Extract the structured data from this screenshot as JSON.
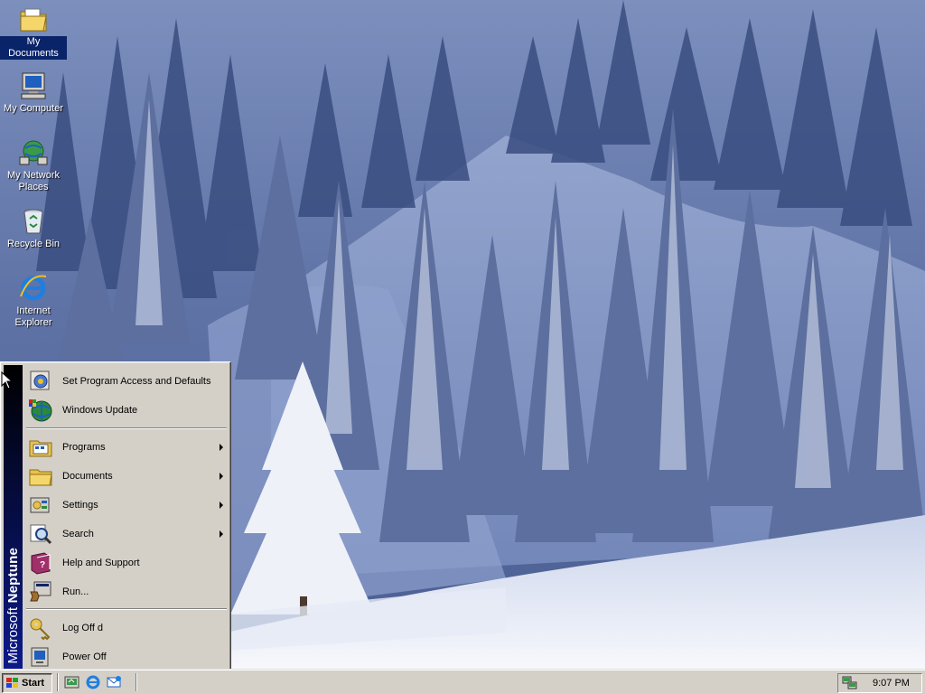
{
  "desktop": {
    "icons": [
      {
        "label": "My Documents",
        "icon": "my-documents-icon",
        "selected": true
      },
      {
        "label": "My Computer",
        "icon": "my-computer-icon"
      },
      {
        "label": "My Network Places",
        "icon": "network-places-icon"
      },
      {
        "label": "Recycle Bin",
        "icon": "recycle-bin-icon"
      },
      {
        "label": "Internet Explorer",
        "icon": "internet-explorer-icon"
      }
    ]
  },
  "start_menu": {
    "banner_prefix": "Microsoft",
    "banner_name": "Neptune",
    "items": [
      {
        "label": "Set Program Access and Defaults",
        "icon": "program-access-icon",
        "submenu": false
      },
      {
        "label": "Windows Update",
        "icon": "windows-update-icon",
        "submenu": false
      },
      {
        "label": "Programs",
        "icon": "programs-folder-icon",
        "submenu": true
      },
      {
        "label": "Documents",
        "icon": "documents-folder-icon",
        "submenu": true
      },
      {
        "label": "Settings",
        "icon": "settings-icon",
        "submenu": true
      },
      {
        "label": "Search",
        "icon": "search-icon",
        "submenu": true
      },
      {
        "label": "Help and Support",
        "icon": "help-book-icon",
        "submenu": false
      },
      {
        "label": "Run...",
        "icon": "run-icon",
        "submenu": false
      },
      {
        "label": "Log Off d",
        "icon": "log-off-key-icon",
        "submenu": false
      },
      {
        "label": "Power Off",
        "icon": "power-off-icon",
        "submenu": false
      }
    ]
  },
  "taskbar": {
    "start_label": "Start",
    "quick_launch": [
      "show-desktop-icon",
      "internet-explorer-icon",
      "outlook-express-icon"
    ],
    "clock": "9:07 PM",
    "tray_icons": [
      "network-tray-icon"
    ]
  },
  "colors": {
    "menu_face": "#d4d0c8",
    "banner_top": "#000000",
    "banner_bottom": "#0c1a8a",
    "selection": "#0a246a",
    "sky": "#8da0c8",
    "snow": "#f4f6fb"
  }
}
